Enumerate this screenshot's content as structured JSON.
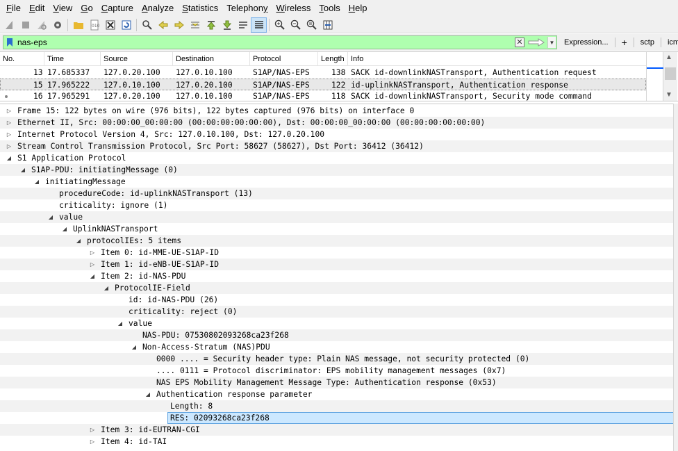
{
  "menu": [
    {
      "acc": "F",
      "rest": "ile"
    },
    {
      "acc": "E",
      "rest": "dit"
    },
    {
      "acc": "V",
      "rest": "iew"
    },
    {
      "acc": "G",
      "rest": "o"
    },
    {
      "acc": "C",
      "rest": "apture"
    },
    {
      "acc": "A",
      "rest": "nalyze"
    },
    {
      "acc": "S",
      "rest": "tatistics"
    },
    {
      "acc": "",
      "pre": "Telephon",
      "accmid": "y",
      "rest": ""
    },
    {
      "acc": "W",
      "rest": "ireless"
    },
    {
      "acc": "T",
      "rest": "ools"
    },
    {
      "acc": "H",
      "rest": "elp"
    }
  ],
  "filter": {
    "value": "nas-eps",
    "expression_label": "Expression...",
    "plus_label": "+",
    "bookmarks": [
      "sctp",
      "icmp"
    ]
  },
  "packet_list": {
    "columns": [
      "No.",
      "Time",
      "Source",
      "Destination",
      "Protocol",
      "Length",
      "Info"
    ],
    "rows": [
      {
        "no": "13",
        "time": "17.685337",
        "source": "127.0.20.100",
        "destination": "127.0.10.100",
        "protocol": "S1AP/NAS-EPS",
        "length": "138",
        "info": "SACK id-downlinkNASTransport, Authentication request"
      },
      {
        "no": "15",
        "time": "17.965222",
        "source": "127.0.10.100",
        "destination": "127.0.20.100",
        "protocol": "S1AP/NAS-EPS",
        "length": "122",
        "info": "id-uplinkNASTransport, Authentication response"
      },
      {
        "no": "16",
        "time": "17.965291",
        "source": "127.0.20.100",
        "destination": "127.0.10.100",
        "protocol": "S1AP/NAS-EPS",
        "length": "118",
        "info": "SACK id-downlinkNASTransport, Security mode command"
      }
    ]
  },
  "details": [
    {
      "text": "Frame 15: 122 bytes on wire (976 bits), 122 bytes captured (976 bits) on interface 0",
      "level": 0,
      "state": "collapsed"
    },
    {
      "text": "Ethernet II, Src: 00:00:00_00:00:00 (00:00:00:00:00:00), Dst: 00:00:00_00:00:00 (00:00:00:00:00:00)",
      "level": 0,
      "state": "collapsed"
    },
    {
      "text": "Internet Protocol Version 4, Src: 127.0.10.100, Dst: 127.0.20.100",
      "level": 0,
      "state": "collapsed"
    },
    {
      "text": "Stream Control Transmission Protocol, Src Port: 58627 (58627), Dst Port: 36412 (36412)",
      "level": 0,
      "state": "collapsed"
    },
    {
      "text": "S1 Application Protocol",
      "level": 0,
      "state": "expanded"
    },
    {
      "text": "S1AP-PDU: initiatingMessage (0)",
      "level": 1,
      "state": "expanded"
    },
    {
      "text": "initiatingMessage",
      "level": 2,
      "state": "expanded"
    },
    {
      "text": "procedureCode: id-uplinkNASTransport (13)",
      "level": 3,
      "state": "leaf"
    },
    {
      "text": "criticality: ignore (1)",
      "level": 3,
      "state": "leaf"
    },
    {
      "text": "value",
      "level": 3,
      "state": "expanded"
    },
    {
      "text": "UplinkNASTransport",
      "level": 4,
      "state": "expanded"
    },
    {
      "text": "protocolIEs: 5 items",
      "level": 5,
      "state": "expanded"
    },
    {
      "text": "Item 0: id-MME-UE-S1AP-ID",
      "level": 6,
      "state": "collapsed"
    },
    {
      "text": "Item 1: id-eNB-UE-S1AP-ID",
      "level": 6,
      "state": "collapsed"
    },
    {
      "text": "Item 2: id-NAS-PDU",
      "level": 6,
      "state": "expanded"
    },
    {
      "text": "ProtocolIE-Field",
      "level": 7,
      "state": "expanded"
    },
    {
      "text": "id: id-NAS-PDU (26)",
      "level": 8,
      "state": "leaf"
    },
    {
      "text": "criticality: reject (0)",
      "level": 8,
      "state": "leaf"
    },
    {
      "text": "value",
      "level": 8,
      "state": "expanded"
    },
    {
      "text": "NAS-PDU: 07530802093268ca23f268",
      "level": 9,
      "state": "leaf"
    },
    {
      "text": "Non-Access-Stratum (NAS)PDU",
      "level": 9,
      "state": "expanded"
    },
    {
      "text": "0000 .... = Security header type: Plain NAS message, not security protected (0)",
      "level": 10,
      "state": "leaf"
    },
    {
      "text": ".... 0111 = Protocol discriminator: EPS mobility management messages (0x7)",
      "level": 10,
      "state": "leaf"
    },
    {
      "text": "NAS EPS Mobility Management Message Type: Authentication response (0x53)",
      "level": 10,
      "state": "leaf"
    },
    {
      "text": "Authentication response parameter",
      "level": 10,
      "state": "expanded"
    },
    {
      "text": "Length: 8",
      "level": 11,
      "state": "leaf"
    },
    {
      "text": "RES: 02093268ca23f268",
      "level": 11,
      "state": "leaf",
      "selected": true
    },
    {
      "text": "Item 3: id-EUTRAN-CGI",
      "level": 6,
      "state": "collapsed"
    },
    {
      "text": "Item 4: id-TAI",
      "level": 6,
      "state": "collapsed"
    }
  ]
}
